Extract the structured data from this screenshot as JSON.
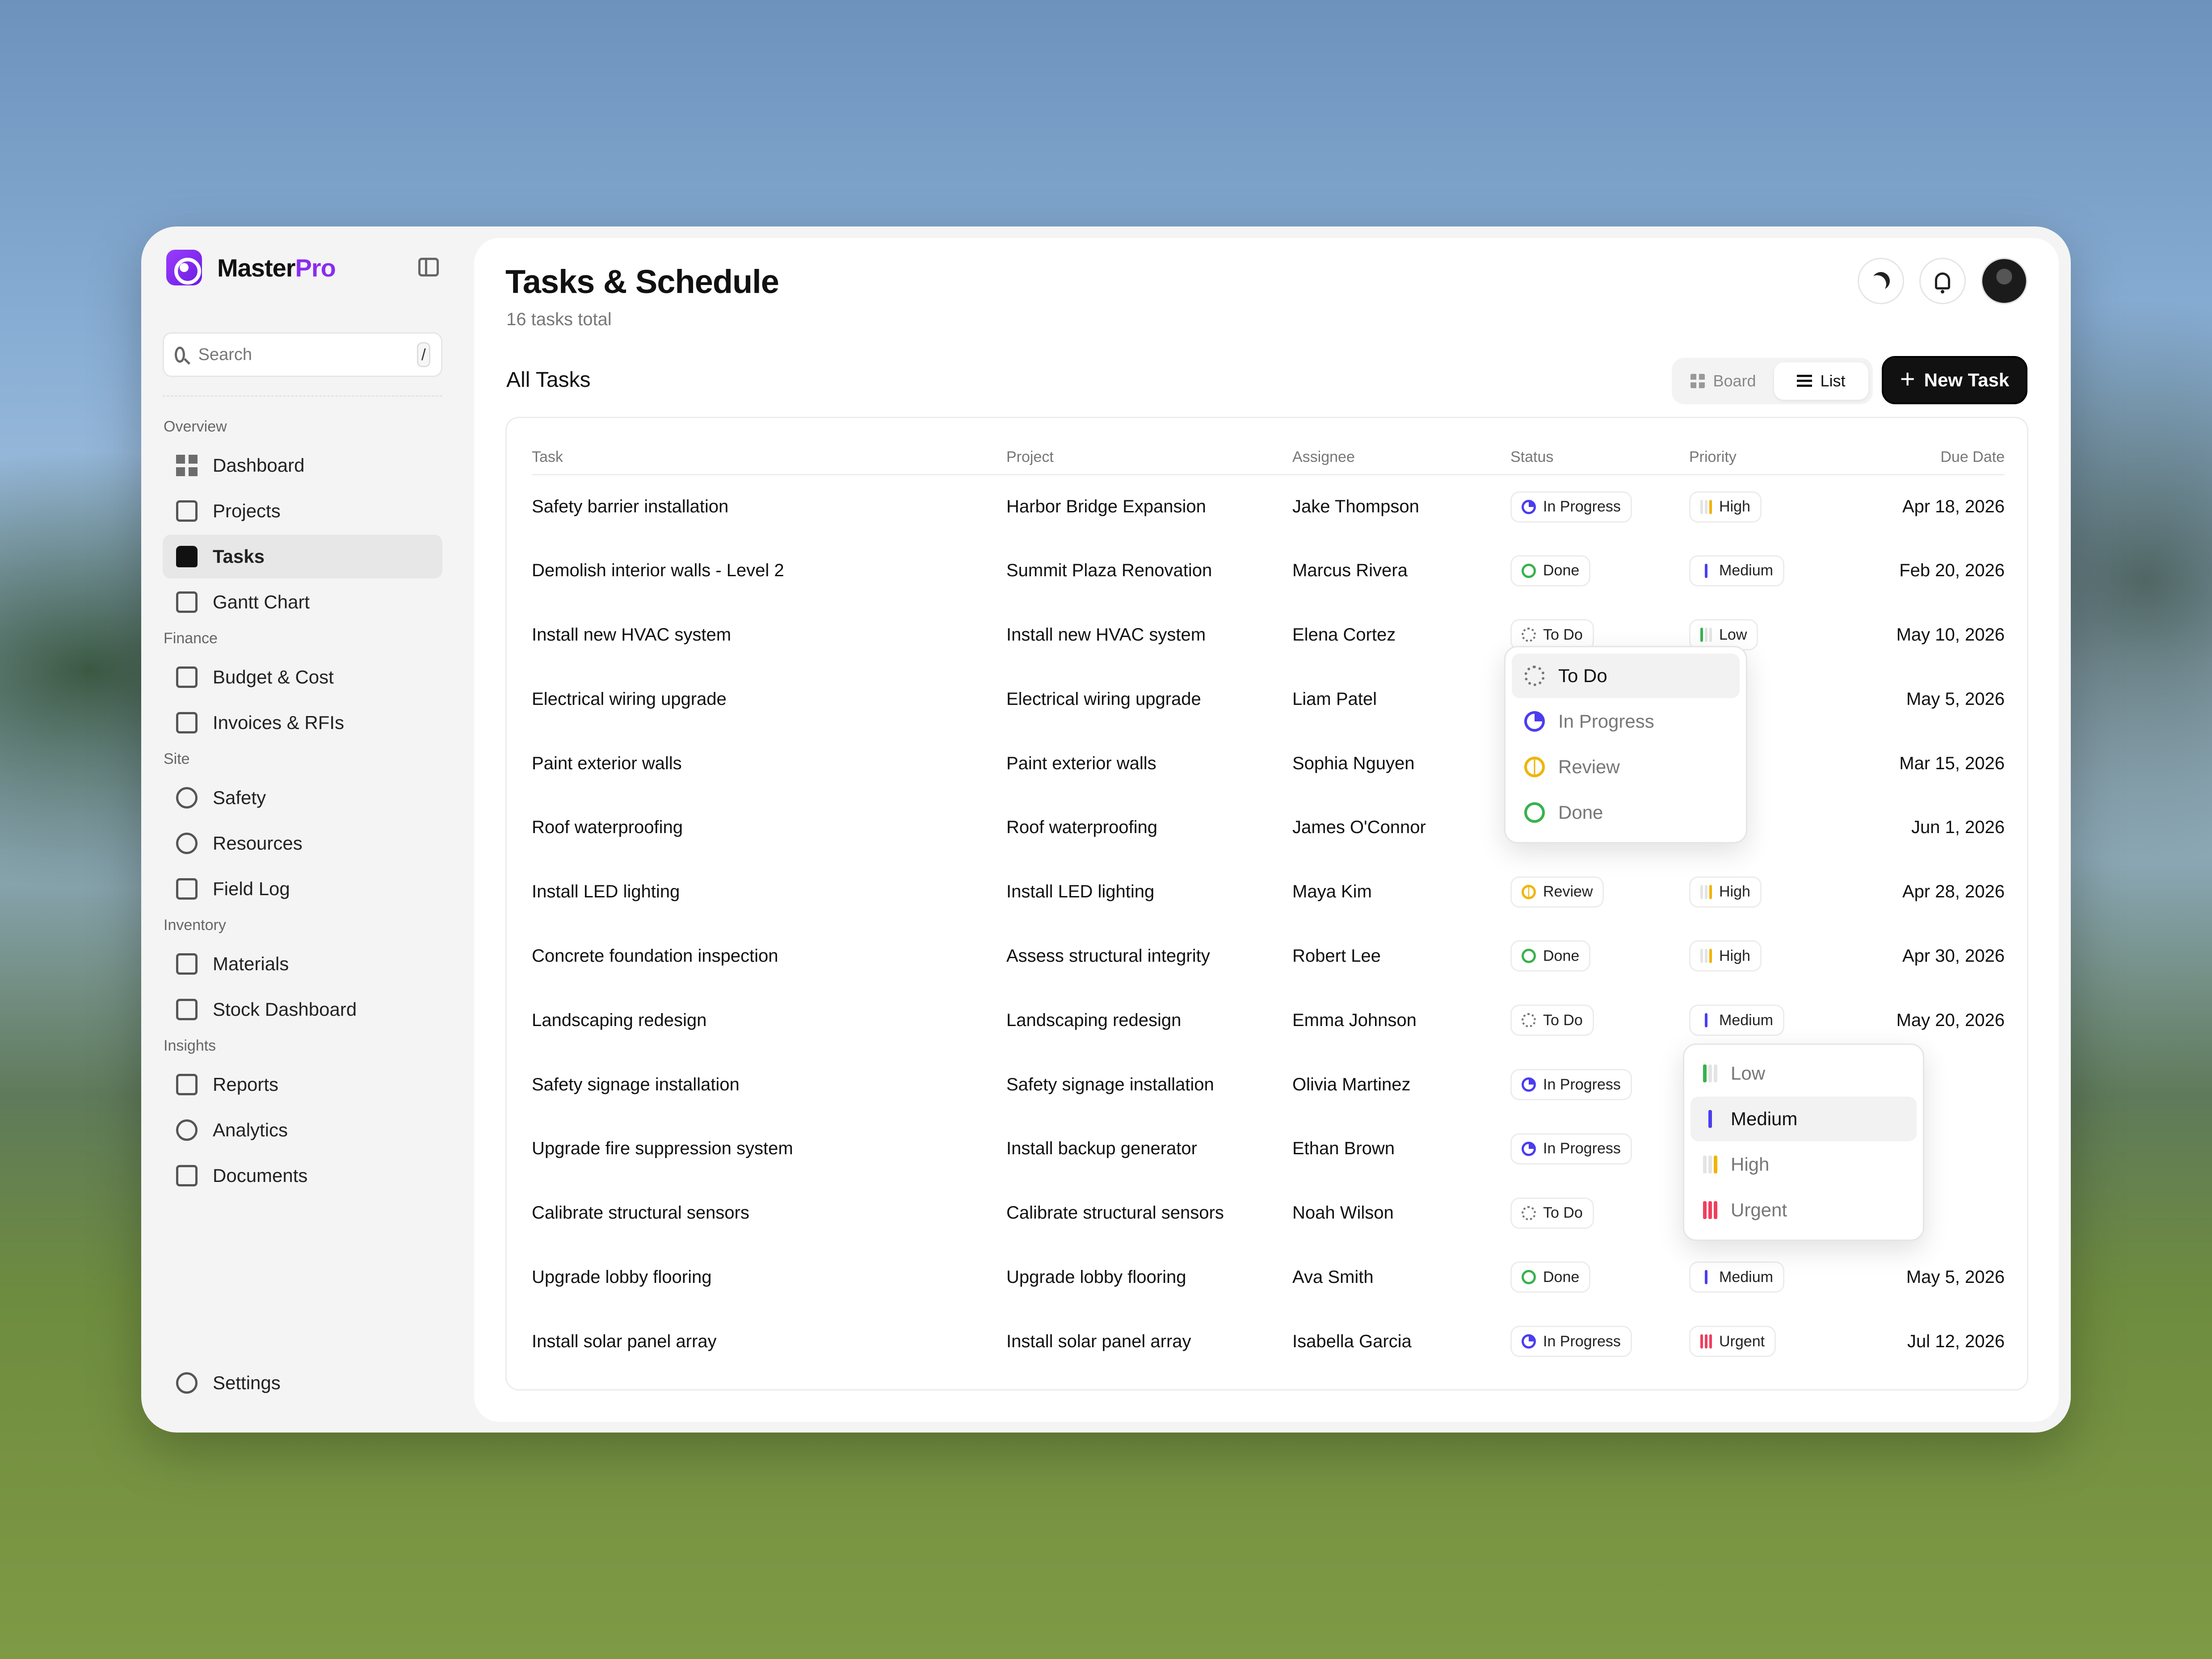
{
  "brand": {
    "name_main": "Master",
    "name_accent": "Pro"
  },
  "search": {
    "placeholder": "Search",
    "shortcut": "/"
  },
  "nav": {
    "sections": [
      {
        "label": "Overview",
        "items": [
          {
            "label": "Dashboard",
            "icon": "dashboard-icon"
          },
          {
            "label": "Projects",
            "icon": "folder-icon"
          },
          {
            "label": "Tasks",
            "icon": "tasks-icon",
            "active": true
          },
          {
            "label": "Gantt Chart",
            "icon": "calendar-icon"
          }
        ]
      },
      {
        "label": "Finance",
        "items": [
          {
            "label": "Budget & Cost",
            "icon": "money-bag-icon"
          },
          {
            "label": "Invoices & RFIs",
            "icon": "invoice-icon"
          }
        ]
      },
      {
        "label": "Site",
        "items": [
          {
            "label": "Safety",
            "icon": "shield-icon"
          },
          {
            "label": "Resources",
            "icon": "helmet-icon"
          },
          {
            "label": "Field Log",
            "icon": "clipboard-icon"
          }
        ]
      },
      {
        "label": "Inventory",
        "items": [
          {
            "label": "Materials",
            "icon": "box-icon"
          },
          {
            "label": "Stock Dashboard",
            "icon": "warehouse-icon"
          }
        ]
      },
      {
        "label": "Insights",
        "items": [
          {
            "label": "Reports",
            "icon": "line-chart-icon"
          },
          {
            "label": "Analytics",
            "icon": "pie-chart-icon"
          },
          {
            "label": "Documents",
            "icon": "folder-open-icon"
          }
        ]
      }
    ],
    "settings_label": "Settings"
  },
  "header": {
    "title": "Tasks & Schedule",
    "subtitle": "16 tasks total"
  },
  "toolbar": {
    "section_title": "All Tasks",
    "board_label": "Board",
    "list_label": "List",
    "new_task_label": "New Task"
  },
  "table": {
    "columns": {
      "task": "Task",
      "project": "Project",
      "assignee": "Assignee",
      "status": "Status",
      "priority": "Priority",
      "due": "Due Date"
    },
    "rows": [
      {
        "task": "Safety barrier installation",
        "project": "Harbor Bridge Expansion",
        "assignee": "Jake Thompson",
        "status": "In Progress",
        "priority": "High",
        "due": "Apr 18, 2026"
      },
      {
        "task": "Demolish interior walls - Level 2",
        "project": "Summit Plaza Renovation",
        "assignee": "Marcus Rivera",
        "status": "Done",
        "priority": "Medium",
        "due": "Feb 20, 2026"
      },
      {
        "task": "Install new HVAC system",
        "project": "Install new HVAC system",
        "assignee": "Elena Cortez",
        "status": "To Do",
        "priority": "Low",
        "due": "May 10, 2026"
      },
      {
        "task": "Electrical wiring upgrade",
        "project": "Electrical wiring upgrade",
        "assignee": "Liam Patel",
        "status": "",
        "priority": "",
        "due": "May 5, 2026"
      },
      {
        "task": "Paint exterior walls",
        "project": "Paint exterior walls",
        "assignee": "Sophia Nguyen",
        "status": "",
        "priority": "",
        "due": "Mar 15, 2026"
      },
      {
        "task": "Roof waterproofing",
        "project": "Roof waterproofing",
        "assignee": "James O'Connor",
        "status": "",
        "priority": "",
        "due": "Jun 1, 2026"
      },
      {
        "task": "Install LED lighting",
        "project": "Install LED lighting",
        "assignee": "Maya Kim",
        "status": "Review",
        "priority": "High",
        "due": "Apr 28, 2026"
      },
      {
        "task": "Concrete foundation inspection",
        "project": "Assess structural integrity",
        "assignee": "Robert Lee",
        "status": "Done",
        "priority": "High",
        "due": "Apr 30, 2026"
      },
      {
        "task": "Landscaping redesign",
        "project": "Landscaping redesign",
        "assignee": "Emma Johnson",
        "status": "To Do",
        "priority": "Medium",
        "due": "May 20, 2026"
      },
      {
        "task": "Safety signage installation",
        "project": "Safety signage installation",
        "assignee": "Olivia Martinez",
        "status": "In Progress",
        "priority": "",
        "due": ""
      },
      {
        "task": "Upgrade fire suppression system",
        "project": "Install backup generator",
        "assignee": "Ethan Brown",
        "status": "In Progress",
        "priority": "",
        "due": ""
      },
      {
        "task": "Calibrate structural sensors",
        "project": "Calibrate structural sensors",
        "assignee": "Noah Wilson",
        "status": "To Do",
        "priority": "",
        "due": ""
      },
      {
        "task": "Upgrade lobby flooring",
        "project": "Upgrade lobby flooring",
        "assignee": "Ava Smith",
        "status": "Done",
        "priority": "Medium",
        "due": "May 5, 2026"
      },
      {
        "task": "Install solar panel array",
        "project": "Install solar panel array",
        "assignee": "Isabella Garcia",
        "status": "In Progress",
        "priority": "Urgent",
        "due": "Jul 12, 2026"
      }
    ]
  },
  "status_dropdown": {
    "options": [
      "To Do",
      "In Progress",
      "Review",
      "Done"
    ],
    "selected": "To Do"
  },
  "priority_dropdown": {
    "options": [
      "Low",
      "Medium",
      "High",
      "Urgent"
    ],
    "selected": "Medium"
  },
  "colors": {
    "accent": "#8a2cf0",
    "in_progress": "#4b3df0",
    "review": "#f0b400",
    "done": "#37b24d",
    "urgent": "#f03e5e"
  }
}
